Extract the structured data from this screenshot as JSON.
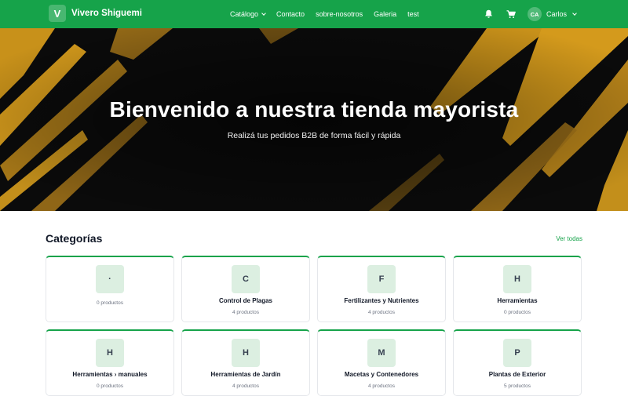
{
  "header": {
    "logo_letter": "V",
    "brand": "Vivero Shiguemi",
    "nav": [
      {
        "label": "Catálogo",
        "dropdown": true
      },
      {
        "label": "Contacto"
      },
      {
        "label": "sobre-nosotros"
      },
      {
        "label": "Galeria"
      },
      {
        "label": "test"
      }
    ],
    "notifications_icon": "bell-icon",
    "cart_icon": "cart-icon",
    "user": {
      "initials": "CA",
      "name": "Carlos"
    }
  },
  "hero": {
    "title": "Bienvenido a nuestra tienda mayorista",
    "subtitle": "Realizá tus pedidos B2B de forma fácil y rápida",
    "colors": {
      "base": "#0b0b0b",
      "accent": "#d49a1c"
    }
  },
  "categories": {
    "title": "Categorías",
    "see_all": "Ver todas",
    "items": [
      {
        "letter": "·",
        "name": "",
        "count": "0 productos"
      },
      {
        "letter": "C",
        "name": "Control de Plagas",
        "count": "4 productos"
      },
      {
        "letter": "F",
        "name": "Fertilizantes y Nutrientes",
        "count": "4 productos"
      },
      {
        "letter": "H",
        "name": "Herramientas",
        "count": "0 productos"
      },
      {
        "letter": "H",
        "name": "Herramientas › manuales",
        "count": "0 productos"
      },
      {
        "letter": "H",
        "name": "Herramientas de Jardín",
        "count": "4 productos"
      },
      {
        "letter": "M",
        "name": "Macetas y Contenedores",
        "count": "4 productos"
      },
      {
        "letter": "P",
        "name": "Plantas de Exterior",
        "count": "5 productos"
      }
    ]
  },
  "colors": {
    "primary": "#16a34a",
    "card_icon_bg": "#dcefe1"
  }
}
